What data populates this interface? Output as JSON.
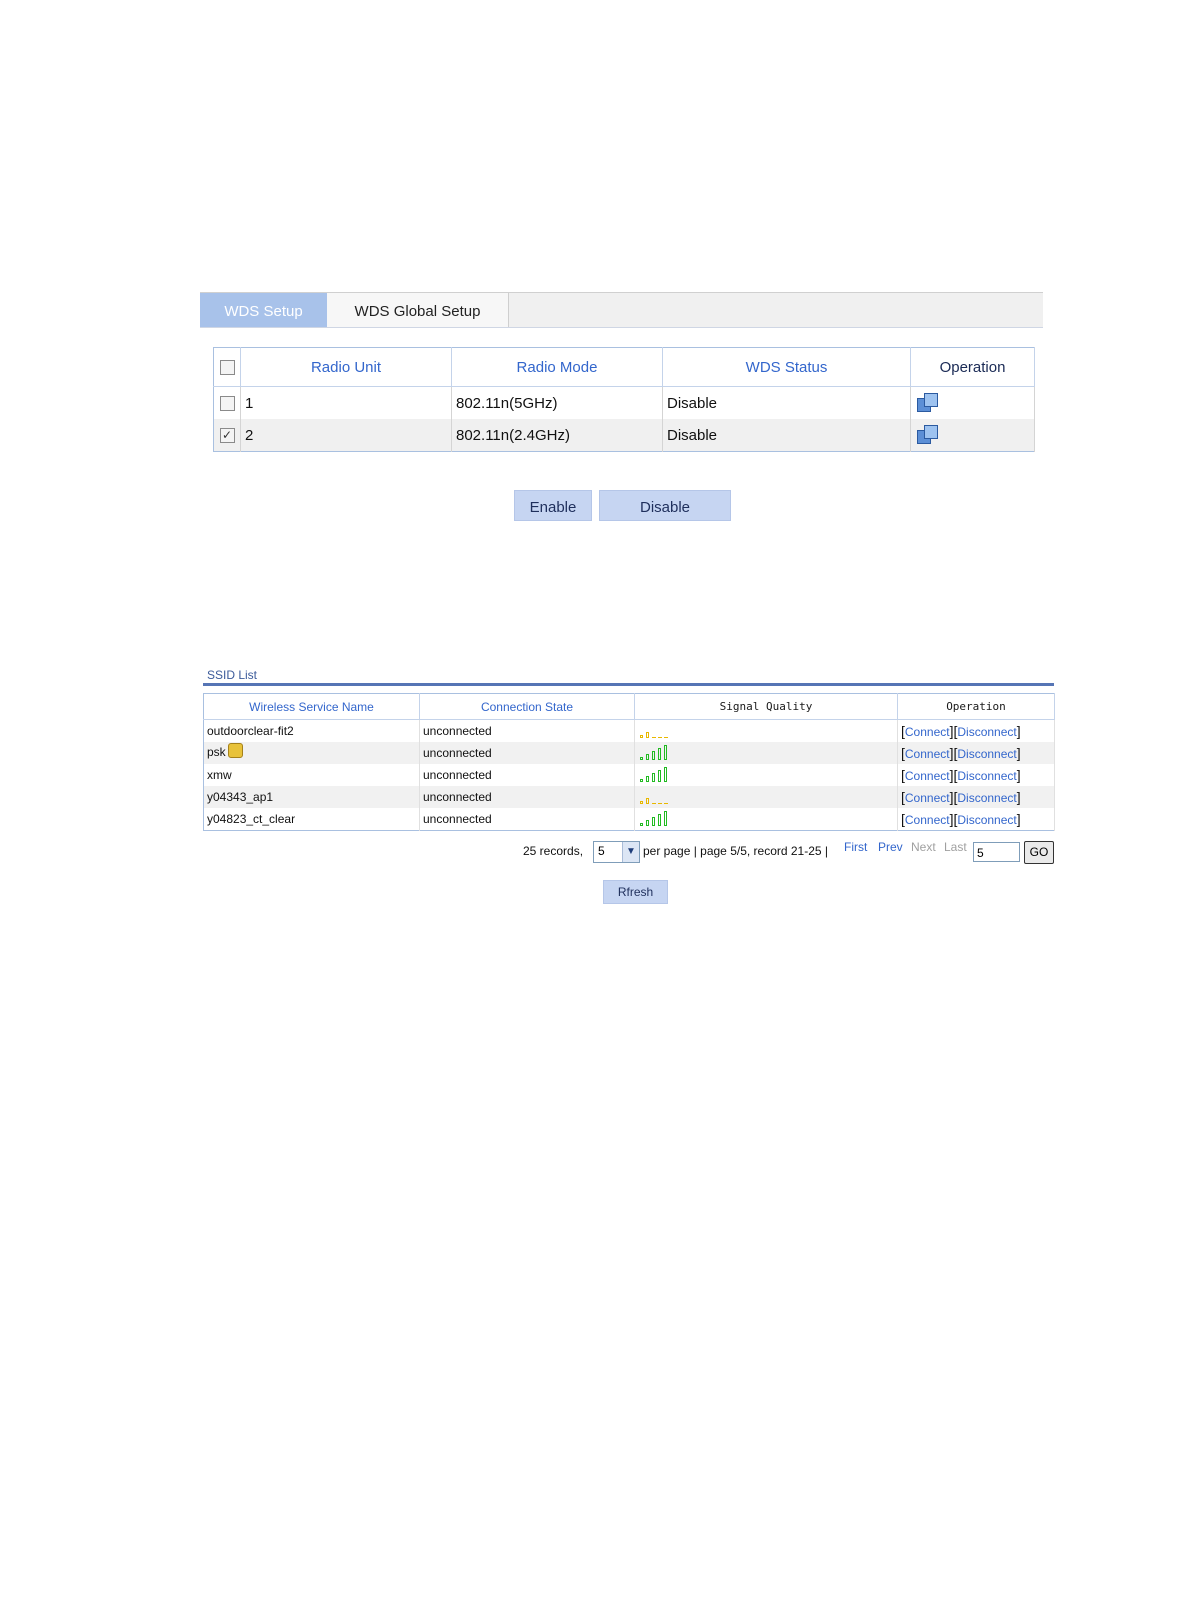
{
  "wds": {
    "tabs": [
      {
        "label": "WDS Setup",
        "active": true
      },
      {
        "label": "WDS Global Setup",
        "active": false
      }
    ],
    "columns": [
      "Radio Unit",
      "Radio Mode",
      "WDS Status",
      "Operation"
    ],
    "rows": [
      {
        "checked": false,
        "radio_unit": "1",
        "radio_mode": "802.11n(5GHz)",
        "wds_status": "Disable",
        "operation_icon": "edit-icon"
      },
      {
        "checked": true,
        "radio_unit": "2",
        "radio_mode": "802.11n(2.4GHz)",
        "wds_status": "Disable",
        "operation_icon": "edit-icon"
      }
    ],
    "enable_label": "Enable",
    "disable_label": "Disable"
  },
  "ssid": {
    "title": "SSID List",
    "columns": [
      "Wireless Service Name",
      "Connection State",
      "Signal Quality",
      "Operation"
    ],
    "rows": [
      {
        "name": "outdoorclear-fit2",
        "state": "unconnected",
        "signal_bars": 2,
        "signal_color": "#e8b800",
        "locked": false
      },
      {
        "name": "psk",
        "state": "unconnected",
        "signal_bars": 5,
        "signal_color": "#22bb22",
        "locked": true
      },
      {
        "name": "xmw",
        "state": "unconnected",
        "signal_bars": 5,
        "signal_color": "#22bb22",
        "locked": false
      },
      {
        "name": "y04343_ap1",
        "state": "unconnected",
        "signal_bars": 2,
        "signal_color": "#e8b800",
        "locked": false
      },
      {
        "name": "y04823_ct_clear",
        "state": "unconnected",
        "signal_bars": 5,
        "signal_color": "#22bb22",
        "locked": false
      }
    ],
    "connect_label": "Connect",
    "disconnect_label": "Disconnect",
    "bracket_open": "[",
    "bracket_close": "]",
    "pager": {
      "records_text": "25 records,",
      "per_page_value": "5",
      "per_page_text": "per page | page 5/5, record 21-25 |",
      "first": "First",
      "prev": "Prev",
      "next": "Next",
      "last": "Last",
      "page_input": "5",
      "go": "GO"
    },
    "refresh_label": "Rfresh"
  },
  "colors": {
    "accent": "#3366cc",
    "tab_active": "#a8c2ea",
    "button": "#c6d5f2"
  }
}
